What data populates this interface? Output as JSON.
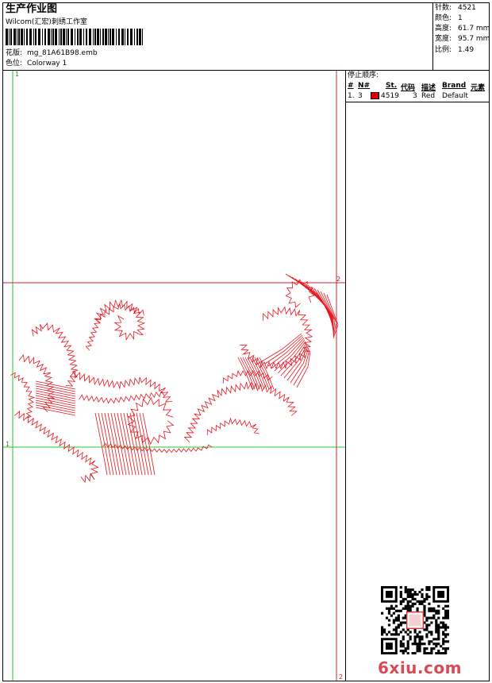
{
  "header": {
    "title": "生产作业图",
    "studio": "Wilcom(汇宏)刺绣工作室",
    "design_label": "花版:",
    "design_value": "mg_81A61B98.emb",
    "color_label": "色位:",
    "color_value": "Colorway 1"
  },
  "stats": {
    "stitches_label": "针数:",
    "stitches_value": "4521",
    "colors_label": "颜色:",
    "colors_value": "1",
    "height_label": "高度:",
    "height_value": "61.7 mm",
    "width_label": "宽度:",
    "width_value": "95.7 mm",
    "scale_label": "比例:",
    "scale_value": "1.49"
  },
  "stop_sequence": {
    "title": "停止顺序:",
    "columns": [
      "#",
      "N#",
      "St.",
      "代码",
      "描述",
      "Brand",
      "元素"
    ],
    "rows": [
      {
        "index": "1.",
        "needle": "3",
        "swatch_color": "#e00000",
        "stitches": "4519",
        "code": "3",
        "desc": "Red",
        "brand": "Default",
        "element": ""
      }
    ]
  },
  "canvas": {
    "guide_labels": {
      "top_left": "1",
      "left_mid": "1",
      "bottom_right": "2",
      "right_mid": "2"
    },
    "stitch_color": "#e8141e",
    "guide_green": "#22cc22",
    "guide_red": "#cc2233"
  },
  "watermark": {
    "text": "6xiu.com"
  }
}
